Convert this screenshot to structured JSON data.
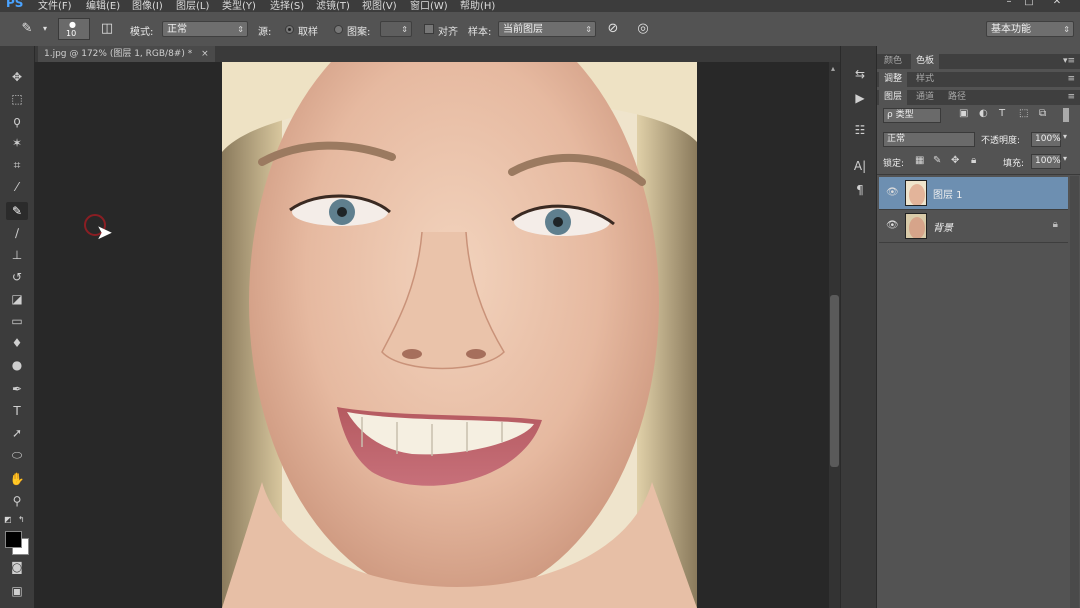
{
  "app": {
    "logo": "PS"
  },
  "menu": [
    "文件(F)",
    "编辑(E)",
    "图像(I)",
    "图层(L)",
    "类型(Y)",
    "选择(S)",
    "滤镜(T)",
    "视图(V)",
    "窗口(W)",
    "帮助(H)"
  ],
  "window_buttons": [
    "–",
    "□",
    "✕"
  ],
  "options_bar": {
    "brush_size": "10",
    "mode_label": "模式:",
    "mode_value": "正常",
    "source_label": "源:",
    "sampled_label": "取样",
    "pattern_label": "图案:",
    "aligned_label": "对齐",
    "sample_label": "样本:",
    "sample_value": "当前图层",
    "workspace_value": "基本功能"
  },
  "document_tab": {
    "title": "1.jpg @ 172% (图层 1, RGB/8#) *",
    "close": "×"
  },
  "panels": {
    "group1_tabs": [
      "颜色",
      "色板"
    ],
    "group2_tabs": [
      "调整",
      "样式"
    ],
    "group3_tabs": [
      "图层",
      "通道",
      "路径"
    ],
    "filter_value": "ρ 类型",
    "blend_mode": "正常",
    "opacity_label": "不透明度:",
    "opacity_value": "100%",
    "lock_label": "锁定:",
    "fill_label": "填充:",
    "fill_value": "100%",
    "layers": [
      {
        "name": "图层 1",
        "selected": true,
        "locked": false
      },
      {
        "name": "背景",
        "selected": false,
        "locked": true
      }
    ]
  },
  "colors": {
    "selected_layer": "#6d8fb1",
    "accent_logo": "#4aa3ff"
  }
}
